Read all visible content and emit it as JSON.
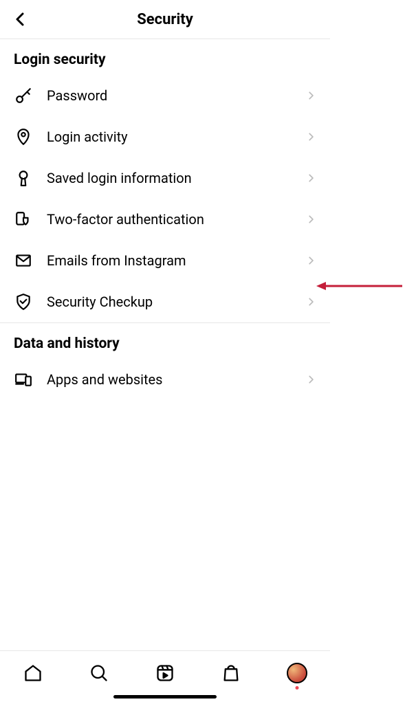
{
  "header": {
    "title": "Security"
  },
  "sections": [
    {
      "title": "Login security",
      "items": [
        {
          "icon": "key-icon",
          "label": "Password"
        },
        {
          "icon": "location-pin-icon",
          "label": "Login activity"
        },
        {
          "icon": "keyhole-icon",
          "label": "Saved login information"
        },
        {
          "icon": "shield-device-icon",
          "label": "Two-factor authentication"
        },
        {
          "icon": "mail-icon",
          "label": "Emails from Instagram"
        },
        {
          "icon": "shield-check-icon",
          "label": "Security Checkup"
        }
      ]
    },
    {
      "title": "Data and history",
      "items": [
        {
          "icon": "devices-icon",
          "label": "Apps and websites"
        }
      ]
    }
  ],
  "bottomNav": {
    "items": [
      "home",
      "search",
      "reels",
      "shop",
      "profile"
    ]
  },
  "annotation": {
    "arrowColor": "#c41e3a"
  }
}
